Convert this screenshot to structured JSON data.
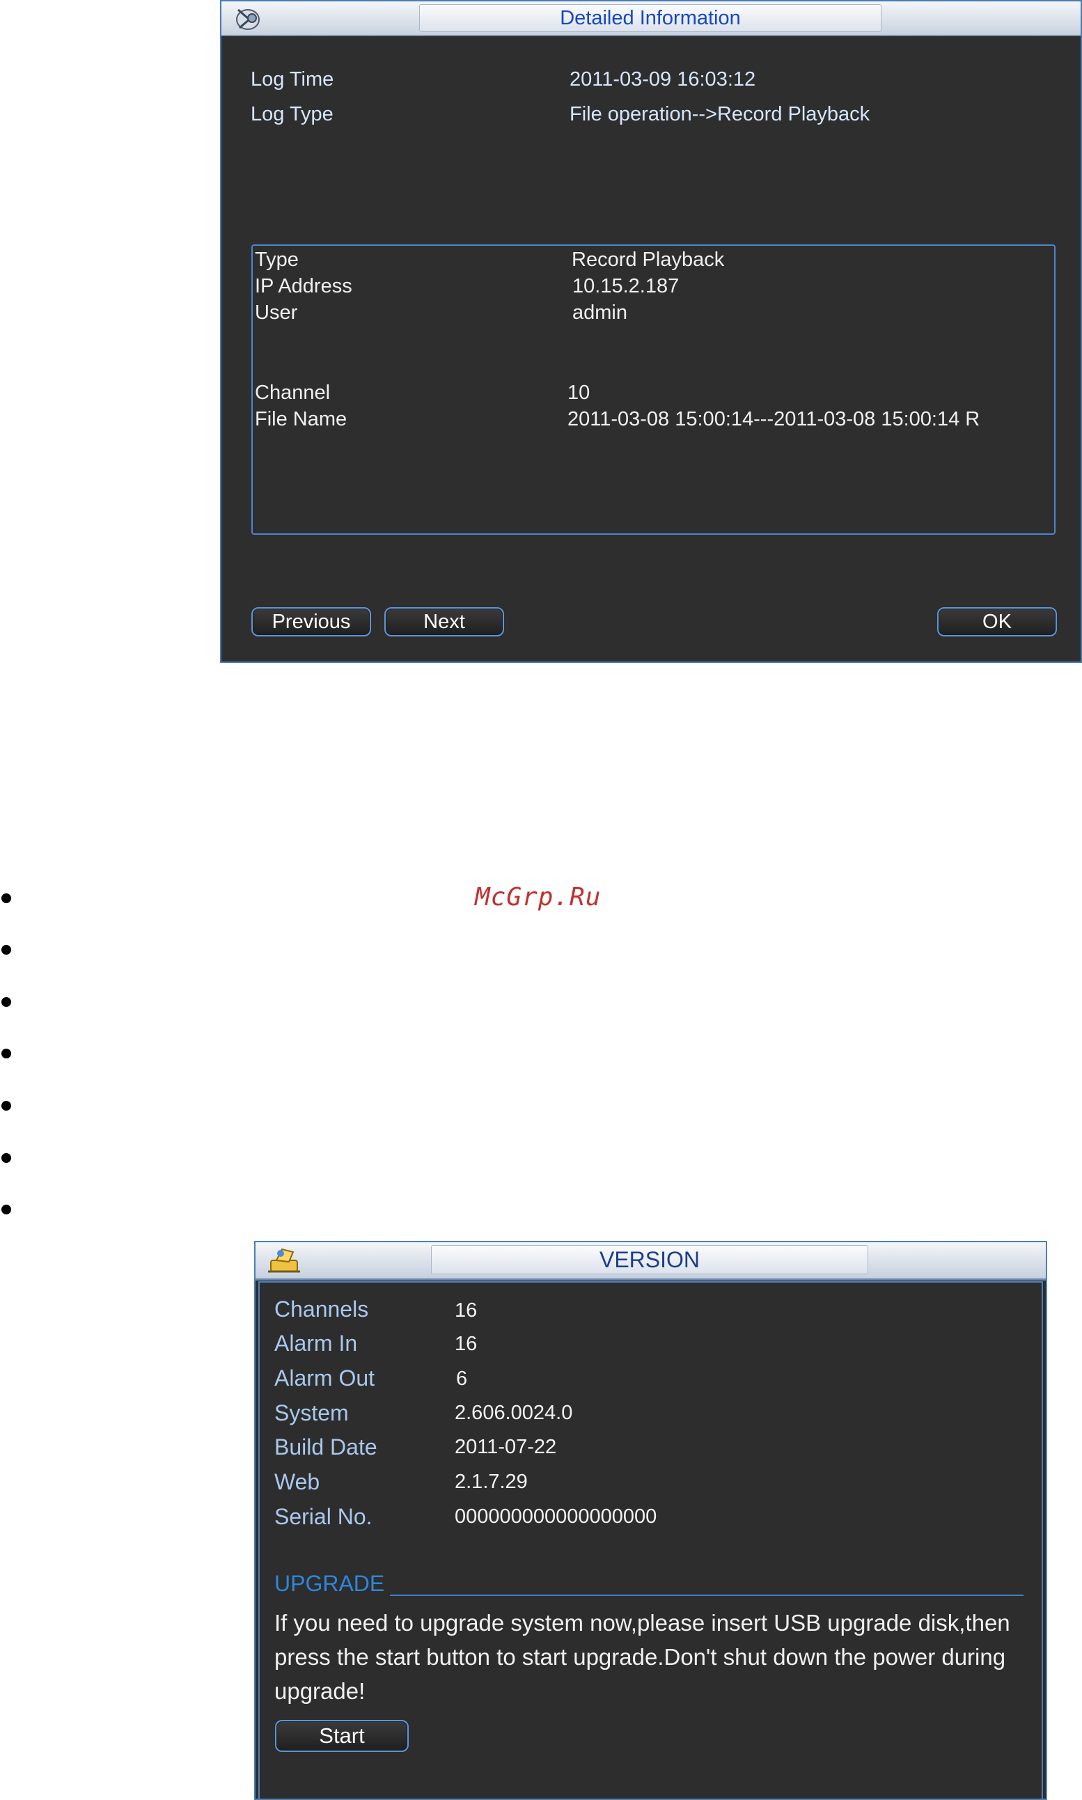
{
  "detail_dialog": {
    "title": "Detailed Information",
    "log_time_label": "Log Time",
    "log_time_value": "2011-03-09 16:03:12",
    "log_type_label": "Log Type",
    "log_type_value": "File operation-->Record Playback",
    "details": {
      "type_label": "Type",
      "type_value": "Record Playback",
      "ip_label": "IP Address",
      "ip_value": "10.15.2.187",
      "user_label": "User",
      "user_value": "admin",
      "channel_label": "Channel",
      "channel_value": "10",
      "file_label": "File Name",
      "file_value": "2011-03-08 15:00:14---2011-03-08 15:00:14 R"
    },
    "buttons": {
      "previous": "Previous",
      "next": "Next",
      "ok": "OK"
    }
  },
  "watermark": "McGrp.Ru",
  "bullet_count": 7,
  "version_dialog": {
    "title": "VERSION",
    "rows": [
      {
        "label": "Channels",
        "value": "16"
      },
      {
        "label": "Alarm In",
        "value": "16"
      },
      {
        "label": "Alarm Out",
        "value": "6"
      },
      {
        "label": "System",
        "value": "2.606.0024.0"
      },
      {
        "label": "Build Date",
        "value": "2011-07-22"
      },
      {
        "label": "Web",
        "value": "2.1.7.29"
      },
      {
        "label": "Serial No.",
        "value": "000000000000000000"
      }
    ],
    "upgrade_title": "UPGRADE",
    "upgrade_text": "If you need to upgrade system now,please insert USB upgrade disk,then press the start button to start upgrade.Don't shut down the power during upgrade!",
    "start_button": "Start"
  },
  "colors": {
    "dialog_bg": "#2e2e2e",
    "accent_border": "#4a86cf",
    "title_text": "#1846c4",
    "label_text": "#d6e6fb",
    "upgrade_title": "#2f86da",
    "watermark": "#c0322e"
  }
}
